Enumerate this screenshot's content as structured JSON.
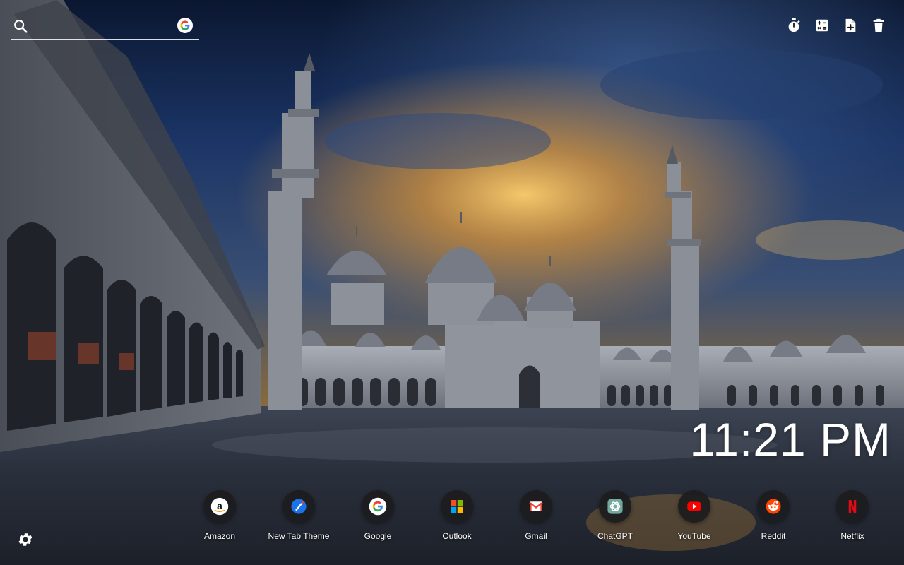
{
  "search": {
    "placeholder": "",
    "value": "",
    "engine_icon": "google-icon"
  },
  "toolbar": {
    "items": [
      {
        "icon": "stopwatch-icon"
      },
      {
        "icon": "calculator-icon"
      },
      {
        "icon": "add-note-icon"
      },
      {
        "icon": "trash-icon"
      }
    ]
  },
  "clock": {
    "time": "11:21 PM"
  },
  "shortcuts": [
    {
      "label": "Amazon",
      "icon": "amazon-icon"
    },
    {
      "label": "New Tab Theme",
      "icon": "new-tab-theme-icon"
    },
    {
      "label": "Google",
      "icon": "google-icon"
    },
    {
      "label": "Outlook",
      "icon": "outlook-icon"
    },
    {
      "label": "Gmail",
      "icon": "gmail-icon"
    },
    {
      "label": "ChatGPT",
      "icon": "chatgpt-icon"
    },
    {
      "label": "YouTube",
      "icon": "youtube-icon"
    },
    {
      "label": "Reddit",
      "icon": "reddit-icon"
    },
    {
      "label": "Netflix",
      "icon": "netflix-icon"
    }
  ],
  "settings": {
    "icon": "gear-icon"
  },
  "colors": {
    "sky_top": "#0d1a33",
    "sky_mid": "#1f3f78",
    "sunset": "#f0a73a",
    "marble": "#9aa0aa",
    "floor": "#2a3140"
  }
}
